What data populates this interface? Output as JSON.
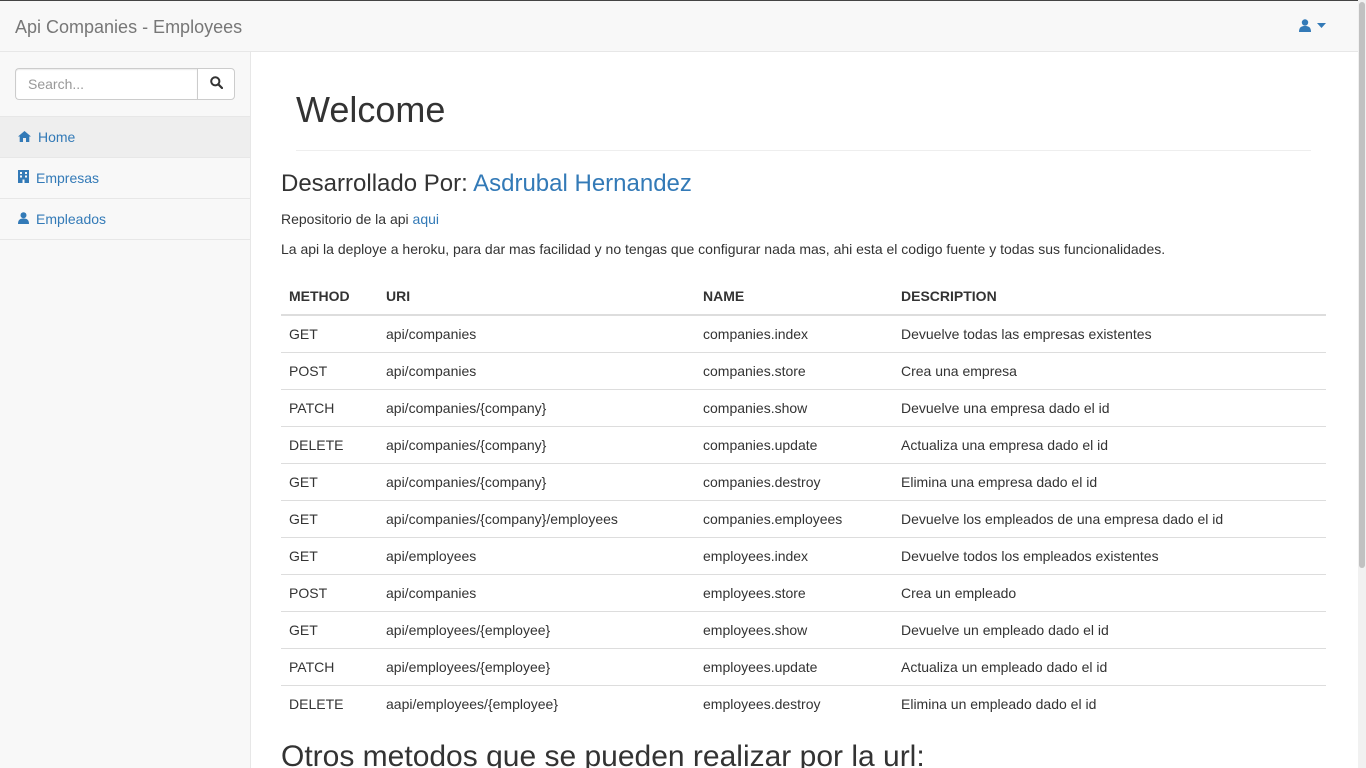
{
  "navbar": {
    "brand": "Api Companies - Employees",
    "user_icon": "user-icon",
    "caret_icon": "caret-down-icon"
  },
  "sidebar": {
    "search": {
      "placeholder": "Search...",
      "value": "",
      "button_icon": "search-icon"
    },
    "items": [
      {
        "label": "Home",
        "icon": "home-icon",
        "active": true
      },
      {
        "label": "Empresas",
        "icon": "building-icon",
        "active": false
      },
      {
        "label": "Empleados",
        "icon": "user-icon",
        "active": false
      }
    ]
  },
  "main": {
    "title": "Welcome",
    "developed_by_label": "Desarrollado Por:",
    "developer_name": "Asdrubal Hernandez",
    "repo_text": "Repositorio de la api",
    "repo_link": "aqui",
    "description": "La api la deploye a heroku, para dar mas facilidad y no tengas que configurar nada mas, ahi esta el codigo fuente y todas sus funcionalidades.",
    "table": {
      "headers": [
        "METHOD",
        "URI",
        "NAME",
        "DESCRIPTION"
      ],
      "rows": [
        [
          "GET",
          "api/companies",
          "companies.index",
          "Devuelve todas las empresas existentes"
        ],
        [
          "POST",
          "api/companies",
          "companies.store",
          "Crea una empresa"
        ],
        [
          "PATCH",
          "api/companies/{company}",
          "companies.show",
          "Devuelve una empresa dado el id"
        ],
        [
          "DELETE",
          "api/companies/{company}",
          "companies.update",
          "Actualiza una empresa dado el id"
        ],
        [
          "GET",
          "api/companies/{company}",
          "companies.destroy",
          "Elimina una empresa dado el id"
        ],
        [
          "GET",
          "api/companies/{company}/employees",
          "companies.employees",
          "Devuelve los empleados de una empresa dado el id"
        ],
        [
          "GET",
          "api/employees",
          "employees.index",
          "Devuelve todos los empleados existentes"
        ],
        [
          "POST",
          "api/companies",
          "employees.store",
          "Crea un empleado"
        ],
        [
          "GET",
          "api/employees/{employee}",
          "employees.show",
          "Devuelve un empleado dado el id"
        ],
        [
          "PATCH",
          "api/employees/{employee}",
          "employees.update",
          "Actualiza un empleado dado el id"
        ],
        [
          "DELETE",
          "aapi/employees/{employee}",
          "employees.destroy",
          "Elimina un empleado dado el id"
        ]
      ]
    },
    "others_title": "Otros metodos que se pueden realizar por la url:"
  },
  "colors": {
    "link": "#337ab7",
    "navbar_bg": "#f8f8f8",
    "text": "#333333",
    "brand": "#777777"
  }
}
